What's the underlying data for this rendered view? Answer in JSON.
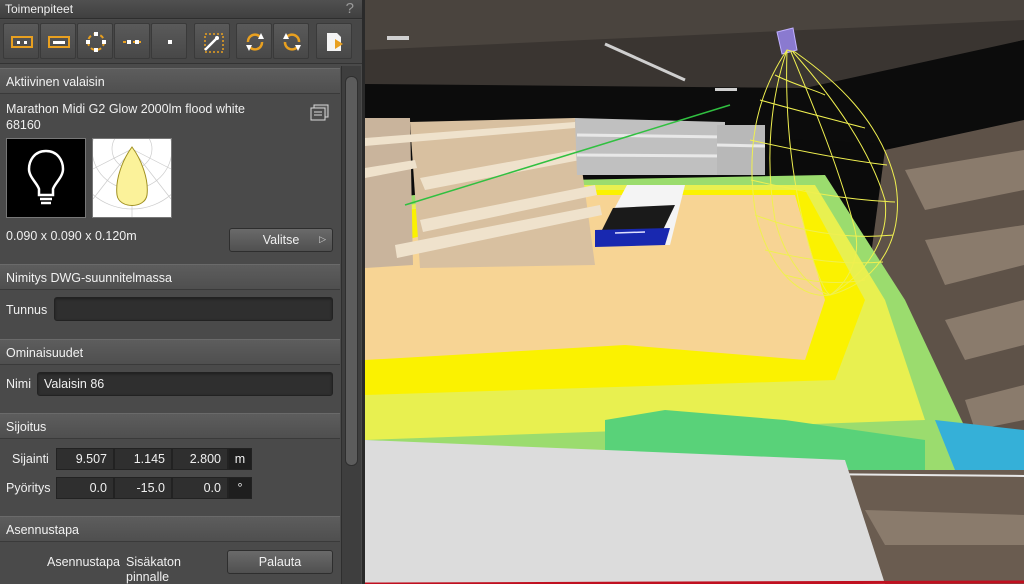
{
  "panel": {
    "title": "Toimenpiteet",
    "help_glyph": "?",
    "toolbar_icons": [
      "move-icon",
      "move-horizontal-icon",
      "rotate-around-icon",
      "align-line-icon",
      "point-icon",
      "magic-wand-icon",
      "rotate-cw-icon",
      "rotate-ccw-icon",
      "export-icon"
    ]
  },
  "active_luminaire": {
    "header": "Aktiivinen valaisin",
    "name": "Marathon Midi G2 Glow 2000lm flood white",
    "code": "68160",
    "dimensions": "0.090 x 0.090 x 0.120m",
    "select_label": "Valitse"
  },
  "dwg": {
    "header": "Nimitys DWG-suunnitelmassa",
    "tunnus_label": "Tunnus",
    "tunnus_value": ""
  },
  "properties": {
    "header": "Ominaisuudet",
    "name_label": "Nimi",
    "name_value": "Valaisin 86"
  },
  "placement": {
    "header": "Sijoitus",
    "position_label": "Sijainti",
    "position": [
      "9.507",
      "1.145",
      "2.800"
    ],
    "position_unit": "m",
    "rotation_label": "Pyöritys",
    "rotation": [
      "0.0",
      "-15.0",
      "0.0"
    ],
    "rotation_unit": "°"
  },
  "mounting": {
    "header": "Asennustapa",
    "label": "Asennustapa",
    "value_line1": "Sisäkaton",
    "value_line2": "pinnalle",
    "reset_label": "Palauta"
  },
  "colors": {
    "accent": "#e8a020",
    "panel_bg": "#4a4a4a",
    "selection_wireframe": "#f0f050"
  }
}
